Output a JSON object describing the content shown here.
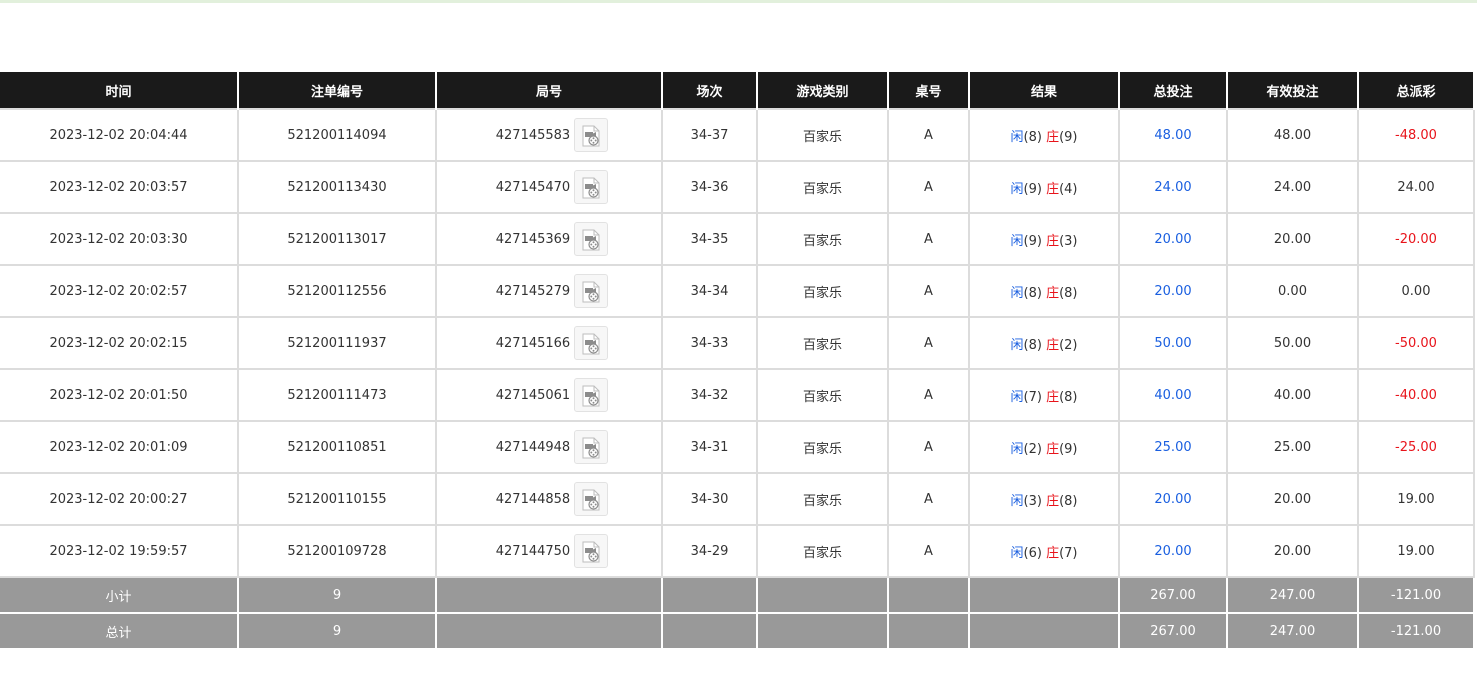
{
  "headers": [
    "时间",
    "注单编号",
    "局号",
    "场次",
    "游戏类别",
    "桌号",
    "结果",
    "总投注",
    "有效投注",
    "总派彩"
  ],
  "rows": [
    {
      "time": "2023-12-02 20:04:44",
      "bet_id": "521200114094",
      "round": "427145583",
      "shoe": "34-37",
      "game": "百家乐",
      "table": "A",
      "player_label": "闲",
      "player_value": "(8)",
      "banker_label": "庄",
      "banker_value": "(9)",
      "total_bet": "48.00",
      "valid_bet": "48.00",
      "payout": "-48.00",
      "payout_color": "red"
    },
    {
      "time": "2023-12-02 20:03:57",
      "bet_id": "521200113430",
      "round": "427145470",
      "shoe": "34-36",
      "game": "百家乐",
      "table": "A",
      "player_label": "闲",
      "player_value": "(9)",
      "banker_label": "庄",
      "banker_value": "(4)",
      "total_bet": "24.00",
      "valid_bet": "24.00",
      "payout": "24.00",
      "payout_color": "normal"
    },
    {
      "time": "2023-12-02 20:03:30",
      "bet_id": "521200113017",
      "round": "427145369",
      "shoe": "34-35",
      "game": "百家乐",
      "table": "A",
      "player_label": "闲",
      "player_value": "(9)",
      "banker_label": "庄",
      "banker_value": "(3)",
      "total_bet": "20.00",
      "valid_bet": "20.00",
      "payout": "-20.00",
      "payout_color": "red"
    },
    {
      "time": "2023-12-02 20:02:57",
      "bet_id": "521200112556",
      "round": "427145279",
      "shoe": "34-34",
      "game": "百家乐",
      "table": "A",
      "player_label": "闲",
      "player_value": "(8)",
      "banker_label": "庄",
      "banker_value": "(8)",
      "total_bet": "20.00",
      "valid_bet": "0.00",
      "payout": "0.00",
      "payout_color": "normal"
    },
    {
      "time": "2023-12-02 20:02:15",
      "bet_id": "521200111937",
      "round": "427145166",
      "shoe": "34-33",
      "game": "百家乐",
      "table": "A",
      "player_label": "闲",
      "player_value": "(8)",
      "banker_label": "庄",
      "banker_value": "(2)",
      "total_bet": "50.00",
      "valid_bet": "50.00",
      "payout": "-50.00",
      "payout_color": "red"
    },
    {
      "time": "2023-12-02 20:01:50",
      "bet_id": "521200111473",
      "round": "427145061",
      "shoe": "34-32",
      "game": "百家乐",
      "table": "A",
      "player_label": "闲",
      "player_value": "(7)",
      "banker_label": "庄",
      "banker_value": "(8)",
      "total_bet": "40.00",
      "valid_bet": "40.00",
      "payout": "-40.00",
      "payout_color": "red"
    },
    {
      "time": "2023-12-02 20:01:09",
      "bet_id": "521200110851",
      "round": "427144948",
      "shoe": "34-31",
      "game": "百家乐",
      "table": "A",
      "player_label": "闲",
      "player_value": "(2)",
      "banker_label": "庄",
      "banker_value": "(9)",
      "total_bet": "25.00",
      "valid_bet": "25.00",
      "payout": "-25.00",
      "payout_color": "red"
    },
    {
      "time": "2023-12-02 20:00:27",
      "bet_id": "521200110155",
      "round": "427144858",
      "shoe": "34-30",
      "game": "百家乐",
      "table": "A",
      "player_label": "闲",
      "player_value": "(3)",
      "banker_label": "庄",
      "banker_value": "(8)",
      "total_bet": "20.00",
      "valid_bet": "20.00",
      "payout": "19.00",
      "payout_color": "normal"
    },
    {
      "time": "2023-12-02 19:59:57",
      "bet_id": "521200109728",
      "round": "427144750",
      "shoe": "34-29",
      "game": "百家乐",
      "table": "A",
      "player_label": "闲",
      "player_value": "(6)",
      "banker_label": "庄",
      "banker_value": "(7)",
      "total_bet": "20.00",
      "valid_bet": "20.00",
      "payout": "19.00",
      "payout_color": "normal"
    }
  ],
  "subtotal": {
    "label": "小计",
    "count": "9",
    "total_bet": "267.00",
    "valid_bet": "247.00",
    "payout": "-121.00"
  },
  "grand_total": {
    "label": "总计",
    "count": "9",
    "total_bet": "267.00",
    "valid_bet": "247.00",
    "payout": "-121.00"
  },
  "icons": {
    "replay": "video-replay-icon"
  },
  "colors": {
    "header_bg": "#1a1a1a",
    "sum_bg": "#999999",
    "bet_blue": "#1a5fe0",
    "negative_red": "#e8141b"
  }
}
